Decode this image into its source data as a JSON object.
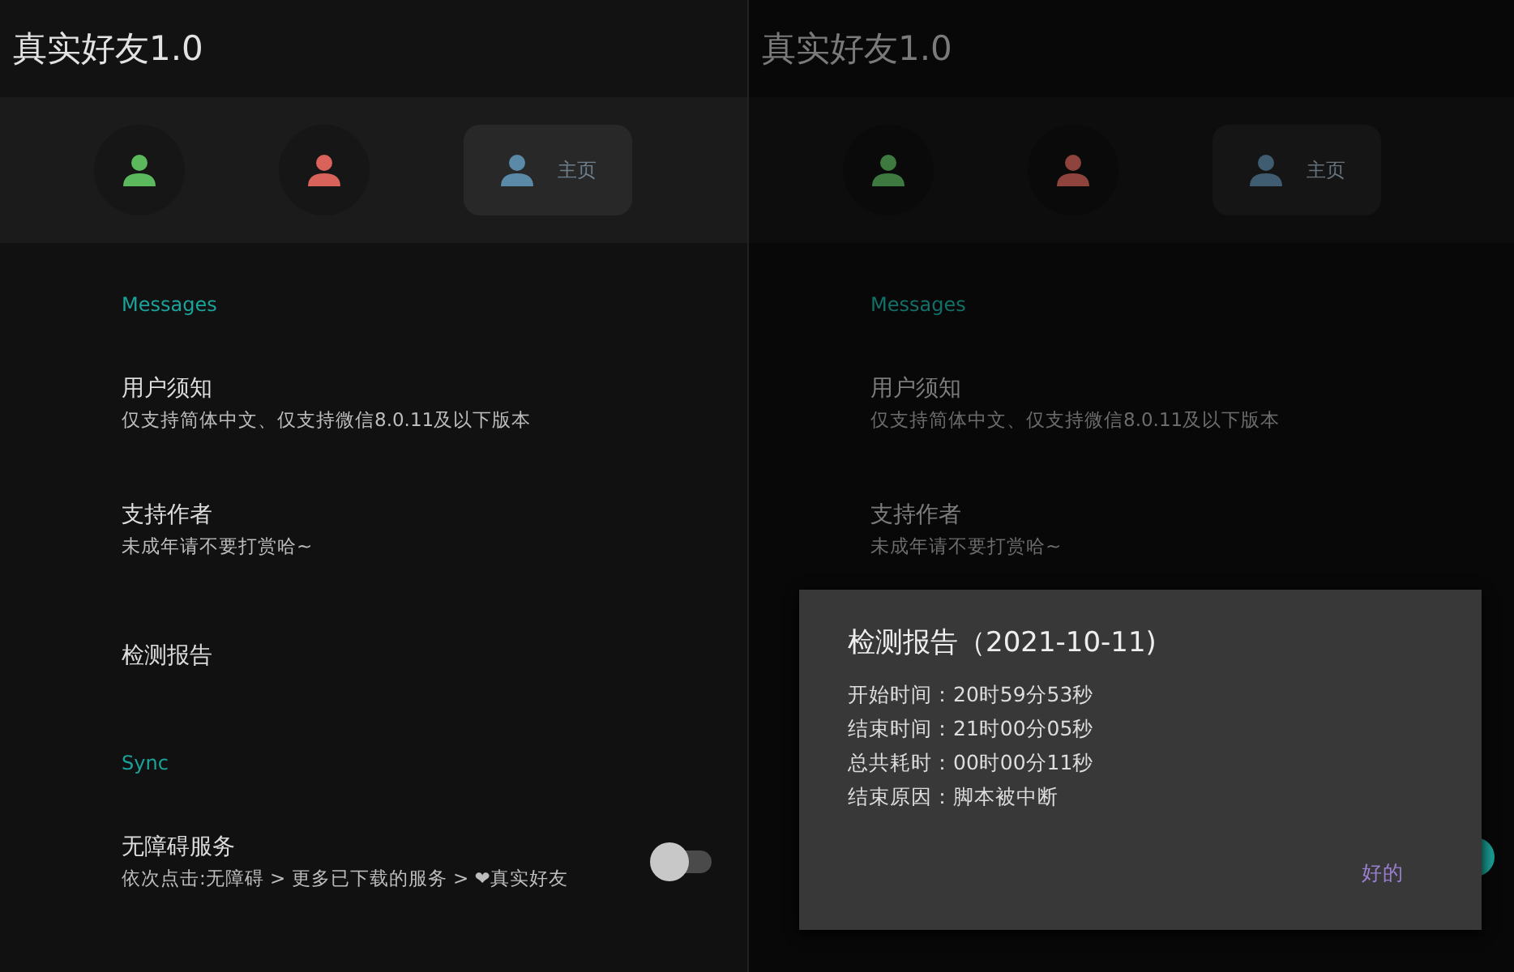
{
  "screens": [
    {
      "dimmed": false,
      "title": "真实好友1.0",
      "tabs": [
        {
          "color": "#5cb85c",
          "selected": false
        },
        {
          "color": "#d9625a",
          "selected": false
        },
        {
          "color": "#5b8aa8",
          "label": "主页",
          "selected": true
        }
      ],
      "sections": [
        {
          "title": "Messages",
          "items": [
            {
              "kind": "text",
              "title": "用户须知",
              "subtitle": "仅支持简体中文、仅支持微信8.0.11及以下版本"
            },
            {
              "kind": "text",
              "title": "支持作者",
              "subtitle": "未成年请不要打赏哈~"
            },
            {
              "kind": "text",
              "title": "检测报告"
            }
          ]
        },
        {
          "title": "Sync",
          "items": [
            {
              "kind": "switch",
              "title": "无障碍服务",
              "subtitle": "依次点击:无障碍 > 更多已下载的服务 > ❤真实好友",
              "on": false
            }
          ]
        }
      ]
    },
    {
      "dimmed": true,
      "title": "真实好友1.0",
      "tabs": [
        {
          "color": "#3e7a40",
          "selected": false
        },
        {
          "color": "#8e433d",
          "selected": false
        },
        {
          "color": "#3f5c70",
          "label": "主页",
          "selected": true
        }
      ],
      "sections": [
        {
          "title": "Messages",
          "items": [
            {
              "kind": "text",
              "title": "用户须知",
              "subtitle": "仅支持简体中文、仅支持微信8.0.11及以下版本"
            },
            {
              "kind": "text",
              "title": "支持作者",
              "subtitle": "未成年请不要打赏哈~"
            }
          ]
        }
      ],
      "covered_switch": {
        "on": true
      },
      "dialog": {
        "title": "检测报告（2021-10-11)",
        "lines": [
          "开始时间：20时59分53秒",
          "结束时间：21时00分05秒",
          "总共耗时：00时00分11秒",
          "结束原因：脚本被中断"
        ],
        "button": "好的"
      }
    }
  ]
}
